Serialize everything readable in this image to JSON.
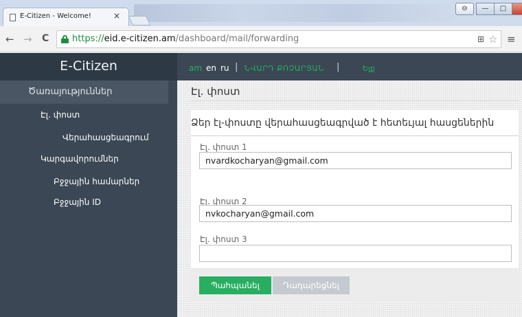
{
  "browser": {
    "tab_title": "E-Citizen - Welcome!",
    "tab_close": "×",
    "url_scheme": "https://",
    "url_host": "eid.e-citizen.am",
    "url_path": "/dashboard/mail/forwarding",
    "back_glyph": "←",
    "forward_glyph": "→",
    "reload_glyph": "C",
    "translate_glyph": "⊞",
    "star_glyph": "☆",
    "menu_glyph": "≡",
    "window_buttons": {
      "minimize": "—",
      "maximize": "□",
      "close": "x",
      "user": "⊖"
    }
  },
  "sidebar": {
    "brand": "E-Citizen",
    "section_title": "Ծառայություններ",
    "items": [
      {
        "label": "Էլ. փոստ"
      },
      {
        "label": "Վերահասցեագրում"
      },
      {
        "label": "Կարգավորումներ"
      },
      {
        "label": "Բջջային համարներ"
      },
      {
        "label": "Բջջային ID"
      }
    ]
  },
  "topbar": {
    "languages": {
      "am": "am",
      "en": "en",
      "ru": "ru"
    },
    "separator": "|",
    "user_name": "ՆՎԱՐԴ ՔՈՉԱՐՅԱՆ",
    "logout": "Ելք"
  },
  "main": {
    "page_title": "Էլ. փոստ",
    "heading": "Ձեր էլ-փոստը վերահասցեագրված է հետեւյալ հասցեներին",
    "fields": [
      {
        "label": "Էլ. փոստ 1",
        "value": "nvardkocharyan@gmail.com"
      },
      {
        "label": "Էլ. փոստ 2",
        "value": "nvkocharyan@gmail.com"
      },
      {
        "label": "Էլ. փոստ 3",
        "value": ""
      }
    ],
    "save_label": "Պահպանել",
    "reset_label": "Դադարեցնել"
  },
  "colors": {
    "accent": "#27ae60",
    "sidebar": "#3b4755",
    "header": "#2d3945"
  }
}
